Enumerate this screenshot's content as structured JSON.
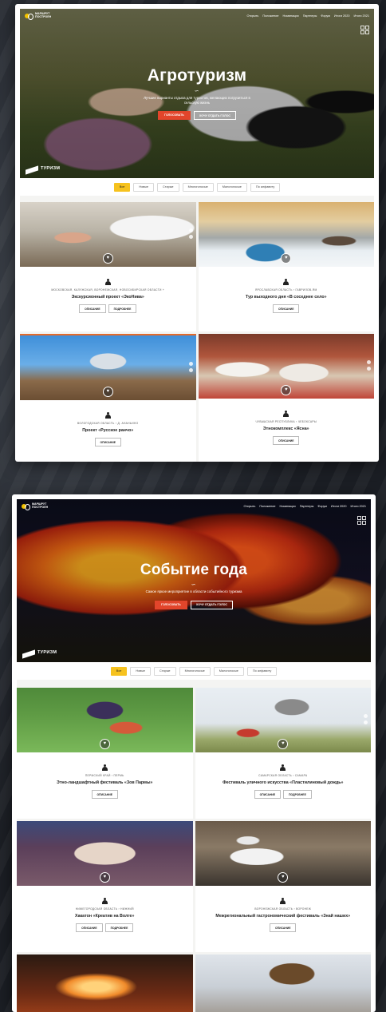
{
  "screens": [
    {
      "logo_text": "Маршрут построен",
      "nav": [
        "Открыть",
        "Положение",
        "Номинации",
        "Партнеры",
        "Форум",
        "Итоги 2020",
        "Итоги 2021"
      ],
      "hero": {
        "title": "Агротуризм",
        "ornament": "∽",
        "subtitle": "Лучшие варианты отдыха для туристов, желающих погрузиться в сельскую жизнь",
        "btn_primary": "Голосовать",
        "btn_secondary": "Хочу отдать голос"
      },
      "tourism_label": "ТУРИЗМ",
      "filters": [
        "Все",
        "Новые",
        "Старые",
        "Многоголосые",
        "Малоголосые",
        "По алфавиту"
      ],
      "cards": [
        {
          "region": "Московская, Калужская, Воронежская, Новосибирская области  +",
          "title": "Экскурсионный проект «ЭкоНива»",
          "buttons": [
            "Описание",
            "Подробнее"
          ]
        },
        {
          "region": "Ярославская область  ›  Гаврилов-Ям",
          "title": "Тур выходного дня «В соседнее село»",
          "buttons": [
            "Описание"
          ]
        },
        {
          "region": "Вологодская область  ›  д. Ананьино",
          "title": "Проект «Русское ранчо»",
          "buttons": [
            "Описание"
          ]
        },
        {
          "region": "Чувашская Республика  ›  Чебоксары",
          "title": "Этнокомплекс «Ясна»",
          "buttons": [
            "Описание"
          ]
        }
      ]
    },
    {
      "logo_text": "Маршрут построен",
      "nav": [
        "Открыть",
        "Положение",
        "Номинации",
        "Партнеры",
        "Форум",
        "Итоги 2020",
        "Итоги 2021"
      ],
      "hero": {
        "title": "Событие года",
        "ornament": "∽",
        "subtitle": "Самое яркое мероприятие в области событийного туризма",
        "btn_primary": "Голосовать",
        "btn_secondary": "Хочу отдать голос"
      },
      "tourism_label": "ТУРИЗМ",
      "filters": [
        "Все",
        "Новые",
        "Старые",
        "Многоголосые",
        "Малоголосые",
        "По алфавиту"
      ],
      "cards": [
        {
          "region": "Пермский край  ›  Пермь",
          "title": "Этно-ландшафтный фестиваль «Зов Пармы»",
          "buttons": [
            "Описание"
          ]
        },
        {
          "region": "Самарская область  ›  Самара",
          "title": "Фестиваль уличного искусства «Пластилиновый дождь»",
          "buttons": [
            "Описание",
            "Подробнее"
          ]
        },
        {
          "region": "Нижегородская область  ›  Нижний",
          "title": "Хакатон «Креатив на Волге»",
          "buttons": [
            "Описание",
            "Подробнее"
          ]
        },
        {
          "region": "Воронежская область  ›  Воронеж",
          "title": "Межрегиональный гастрономический фестиваль «Знай наших»",
          "buttons": [
            "Описание"
          ]
        }
      ]
    }
  ]
}
